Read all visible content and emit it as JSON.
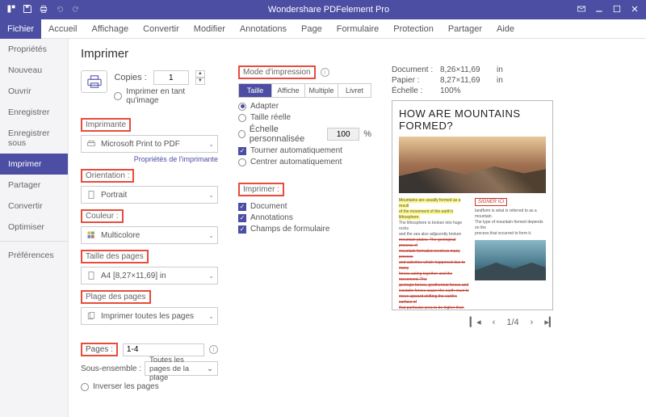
{
  "app_title": "Wondershare PDFelement Pro",
  "menubar": [
    "Fichier",
    "Accueil",
    "Affichage",
    "Convertir",
    "Modifier",
    "Annotations",
    "Page",
    "Formulaire",
    "Protection",
    "Partager",
    "Aide"
  ],
  "menubar_active": 0,
  "sidebar": {
    "items": [
      "Propriétés",
      "Nouveau",
      "Ouvrir",
      "Enregistrer",
      "Enregistrer sous",
      "Imprimer",
      "Partager",
      "Convertir",
      "Optimiser"
    ],
    "active": 5,
    "footer": "Préférences"
  },
  "print": {
    "title": "Imprimer",
    "copies_label": "Copies :",
    "copies_value": "1",
    "print_as_image": "Imprimer en tant qu'image",
    "printer_section": "Imprimante",
    "printer_value": "Microsoft Print to PDF",
    "printer_props": "Propriétés de l'imprimante",
    "orientation_section": "Orientation :",
    "orientation_value": "Portrait",
    "color_section": "Couleur :",
    "color_value": "Multicolore",
    "pagesize_section": "Taille des pages",
    "pagesize_value": "A4 [8,27×11,69] in",
    "pagerange_section": "Plage des pages",
    "pagerange_value": "Imprimer toutes les pages",
    "pages_label": "Pages :",
    "pages_value": "1-4",
    "subset_label": "Sous-ensemble :",
    "subset_value": "Toutes les pages de la plage",
    "reverse_pages": "Inverser les pages"
  },
  "mode": {
    "section": "Mode d'impression",
    "tabs": [
      "Taille",
      "Affiche",
      "Multiple",
      "Livret"
    ],
    "active": 0,
    "adapt": "Adapter",
    "real_size": "Taille réelle",
    "custom_scale": "Échelle personnalisée",
    "custom_scale_value": "100",
    "percent": "%",
    "auto_rotate": "Tourner automatiquement",
    "auto_center": "Centrer automatiquement",
    "print_section": "Imprimer :",
    "opt_document": "Document",
    "opt_annotations": "Annotations",
    "opt_formfields": "Champs de formulaire"
  },
  "preview": {
    "doc_label": "Document :",
    "doc_value": "8,26×11,69",
    "unit": "in",
    "paper_label": "Papier :",
    "paper_value": "8,27×11,69",
    "scale_label": "Échelle :",
    "scale_value": "100%",
    "page_title": "HOW ARE MOUNTAINS FORMED?",
    "signer": "SIGNER ICI",
    "pager_text": "1/4"
  }
}
